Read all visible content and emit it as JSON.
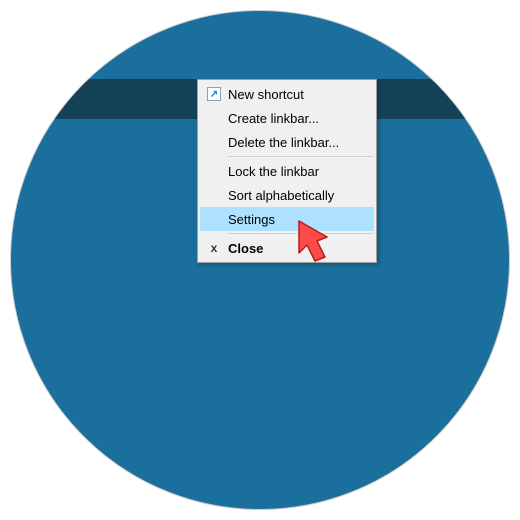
{
  "menu": {
    "items": [
      {
        "label": "New shortcut"
      },
      {
        "label": "Create linkbar..."
      },
      {
        "label": "Delete the linkbar..."
      },
      {
        "label": "Lock the linkbar"
      },
      {
        "label": "Sort alphabetically"
      },
      {
        "label": "Settings"
      },
      {
        "label": "Close"
      }
    ],
    "highlighted_index": 5
  },
  "colors": {
    "desktop": "#1b6f9c",
    "taskbar": "#164257",
    "highlight": "#aee1ff",
    "arrow": "#ff4a4a"
  }
}
